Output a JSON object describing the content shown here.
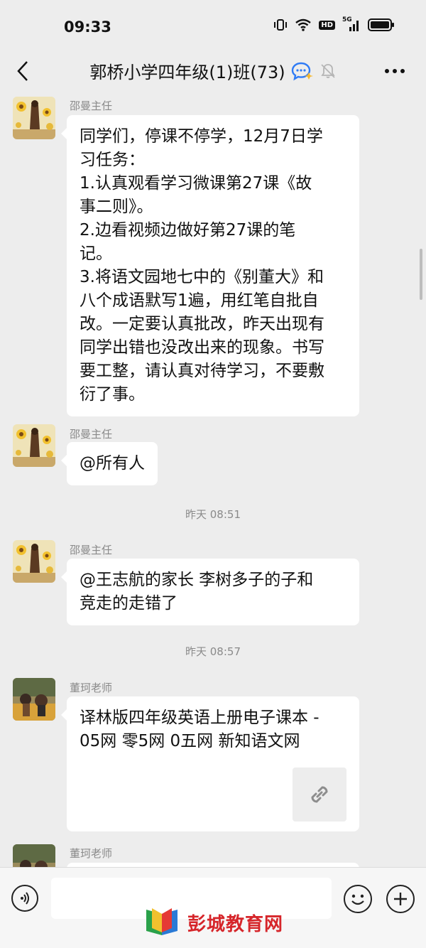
{
  "status": {
    "time": "09:33",
    "hd": "HD",
    "network": "5G"
  },
  "header": {
    "back_icon": "chevron-left-icon",
    "title": "郭桥小学四年级(1)班(73)",
    "more_icon": "more-dots-icon"
  },
  "messages": [
    {
      "sender": "邵曼主任",
      "lines": [
        "同学们，停课不停学，12月7日学",
        "习任务：",
        "1.认真观看学习微课第27课《故",
        "事二则》。",
        "2.边看视频边做好第27课的笔",
        "记。",
        "3.将语文园地七中的《别董大》和",
        "八个成语默写1遍，用红笔自批自",
        "改。一定要认真批改，昨天出现有",
        "同学出错也没改出来的现象。书写",
        "要工整，请认真对待学习，不要敷",
        "衍了事。"
      ]
    },
    {
      "sender": "邵曼主任",
      "lines": [
        "@所有人"
      ]
    },
    {
      "timestamp": "昨天 08:51"
    },
    {
      "sender": "邵曼主任",
      "lines": [
        "@王志航的家长  李树多子的子和",
        "竞走的走错了"
      ]
    },
    {
      "timestamp": "昨天 08:57"
    },
    {
      "sender": "董珂老师",
      "lines": [
        "译林版四年级英语上册电子课本 -",
        "05网 零5网 0五网 新知语文网"
      ],
      "attachment_icon": "link-icon"
    },
    {
      "sender": "董珂老师"
    }
  ],
  "input": {
    "placeholder": ""
  },
  "watermark": {
    "text": "彭城教育网"
  },
  "colors": {
    "background": "#ededed",
    "bubble": "#ffffff",
    "meta_text": "#8a8a8a",
    "watermark_red": "#d6252a"
  }
}
